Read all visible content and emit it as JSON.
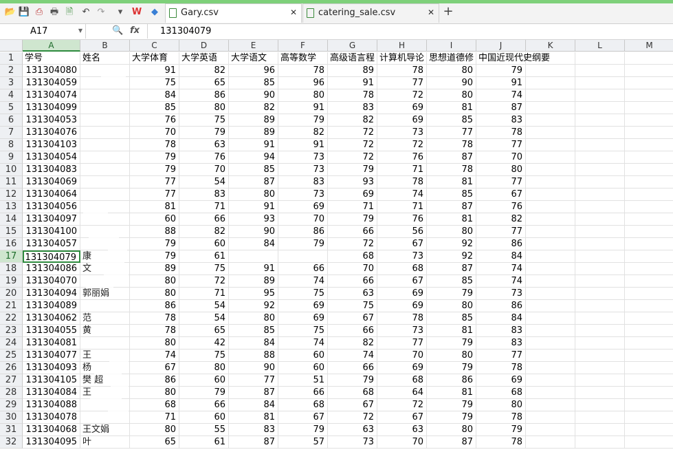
{
  "tabs": [
    {
      "label": "Gary.csv",
      "active": true
    },
    {
      "label": "catering_sale.csv",
      "active": false
    }
  ],
  "toolbar_icons": [
    "open-folder-icon",
    "save-icon",
    "export-pdf-icon",
    "print-icon",
    "print-preview-icon",
    "undo-icon",
    "redo-icon",
    "dropdown-icon",
    "wps-logo-icon",
    "cube-icon"
  ],
  "formula": {
    "name_box": "A17",
    "fx": "fx",
    "value": "131304079"
  },
  "columns": [
    "A",
    "B",
    "C",
    "D",
    "E",
    "F",
    "G",
    "H",
    "I",
    "J",
    "K",
    "L",
    "M"
  ],
  "header_row": [
    "学号",
    "姓名",
    "大学体育",
    "大学英语",
    "大学语文",
    "高等数学",
    "高级语言程",
    "计算机导论",
    "思想道德修",
    "中国近现代史纲要"
  ],
  "rows": [
    {
      "id": "131304080",
      "scores": [
        "91",
        "82",
        "96",
        "78",
        "89",
        "78",
        "80",
        "79"
      ]
    },
    {
      "id": "131304059",
      "scores": [
        "75",
        "65",
        "85",
        "96",
        "91",
        "77",
        "90",
        "91"
      ]
    },
    {
      "id": "131304074",
      "scores": [
        "84",
        "86",
        "90",
        "80",
        "78",
        "72",
        "80",
        "74"
      ]
    },
    {
      "id": "131304099",
      "scores": [
        "85",
        "80",
        "82",
        "91",
        "83",
        "69",
        "81",
        "87"
      ]
    },
    {
      "id": "131304053",
      "scores": [
        "76",
        "75",
        "89",
        "79",
        "82",
        "69",
        "85",
        "83"
      ]
    },
    {
      "id": "131304076",
      "scores": [
        "70",
        "79",
        "89",
        "82",
        "72",
        "73",
        "77",
        "78"
      ]
    },
    {
      "id": "131304103",
      "scores": [
        "78",
        "63",
        "91",
        "91",
        "72",
        "72",
        "78",
        "77"
      ]
    },
    {
      "id": "131304054",
      "scores": [
        "79",
        "76",
        "94",
        "73",
        "72",
        "76",
        "87",
        "70"
      ]
    },
    {
      "id": "131304083",
      "scores": [
        "79",
        "70",
        "85",
        "73",
        "79",
        "71",
        "78",
        "80"
      ]
    },
    {
      "id": "131304069",
      "scores": [
        "77",
        "54",
        "87",
        "83",
        "93",
        "78",
        "81",
        "77"
      ]
    },
    {
      "id": "131304064",
      "scores": [
        "77",
        "83",
        "80",
        "73",
        "69",
        "74",
        "85",
        "67"
      ]
    },
    {
      "id": "131304056",
      "scores": [
        "81",
        "71",
        "91",
        "69",
        "71",
        "71",
        "87",
        "76"
      ]
    },
    {
      "id": "131304097",
      "scores": [
        "60",
        "66",
        "93",
        "70",
        "79",
        "76",
        "81",
        "82"
      ]
    },
    {
      "id": "131304100",
      "scores": [
        "88",
        "82",
        "90",
        "86",
        "66",
        "56",
        "80",
        "77"
      ]
    },
    {
      "id": "131304057",
      "scores": [
        "79",
        "60",
        "84",
        "79",
        "72",
        "67",
        "92",
        "86"
      ]
    },
    {
      "id": "131304079",
      "scores": [
        "79",
        "61",
        "",
        "",
        "68",
        "73",
        "92",
        "84"
      ]
    },
    {
      "id": "131304086",
      "scores": [
        "89",
        "75",
        "91",
        "66",
        "70",
        "68",
        "87",
        "74"
      ]
    },
    {
      "id": "131304070",
      "scores": [
        "80",
        "72",
        "89",
        "74",
        "66",
        "67",
        "85",
        "74"
      ]
    },
    {
      "id": "131304094",
      "scores": [
        "80",
        "71",
        "95",
        "75",
        "63",
        "69",
        "79",
        "73"
      ]
    },
    {
      "id": "131304089",
      "scores": [
        "86",
        "54",
        "92",
        "69",
        "75",
        "69",
        "80",
        "86"
      ]
    },
    {
      "id": "131304062",
      "scores": [
        "78",
        "54",
        "80",
        "69",
        "67",
        "78",
        "85",
        "84"
      ]
    },
    {
      "id": "131304055",
      "scores": [
        "78",
        "65",
        "85",
        "75",
        "66",
        "73",
        "81",
        "83"
      ]
    },
    {
      "id": "131304081",
      "scores": [
        "80",
        "42",
        "84",
        "74",
        "82",
        "77",
        "79",
        "83"
      ]
    },
    {
      "id": "131304077",
      "scores": [
        "74",
        "75",
        "88",
        "60",
        "74",
        "70",
        "80",
        "77"
      ]
    },
    {
      "id": "131304093",
      "scores": [
        "67",
        "80",
        "90",
        "60",
        "66",
        "69",
        "79",
        "78"
      ]
    },
    {
      "id": "131304105",
      "scores": [
        "86",
        "60",
        "77",
        "51",
        "79",
        "68",
        "86",
        "69"
      ]
    },
    {
      "id": "131304084",
      "scores": [
        "80",
        "79",
        "87",
        "66",
        "68",
        "64",
        "81",
        "68"
      ]
    },
    {
      "id": "131304088",
      "scores": [
        "68",
        "66",
        "84",
        "68",
        "67",
        "72",
        "79",
        "80"
      ]
    },
    {
      "id": "131304078",
      "scores": [
        "71",
        "60",
        "81",
        "67",
        "72",
        "67",
        "79",
        "78"
      ]
    },
    {
      "id": "131304068",
      "scores": [
        "80",
        "55",
        "83",
        "79",
        "63",
        "63",
        "80",
        "79"
      ]
    },
    {
      "id": "131304095",
      "scores": [
        "65",
        "61",
        "87",
        "57",
        "73",
        "70",
        "87",
        "78"
      ]
    }
  ],
  "names": [
    "",
    "",
    "",
    "",
    "",
    "",
    "",
    "",
    "",
    "",
    "",
    "",
    "",
    "",
    "",
    "",
    "",
    "",
    "",
    "",
    "",
    "",
    "",
    "",
    "",
    "",
    "",
    "",
    "",
    "",
    ""
  ],
  "visible_name_fragments": {
    "row17": "康",
    "row18": "文",
    "row20": "郭丽娟",
    "row22": "范",
    "row23": "黄",
    "row25": "王",
    "row26": "杨",
    "row27": "樊 超",
    "row28": "王",
    "row31": "王文娟",
    "row32": "叶"
  },
  "selection": {
    "row": 17,
    "col": "A"
  },
  "colors": {
    "accent": "#2e8b3e",
    "header_bg": "#eef0f3"
  }
}
